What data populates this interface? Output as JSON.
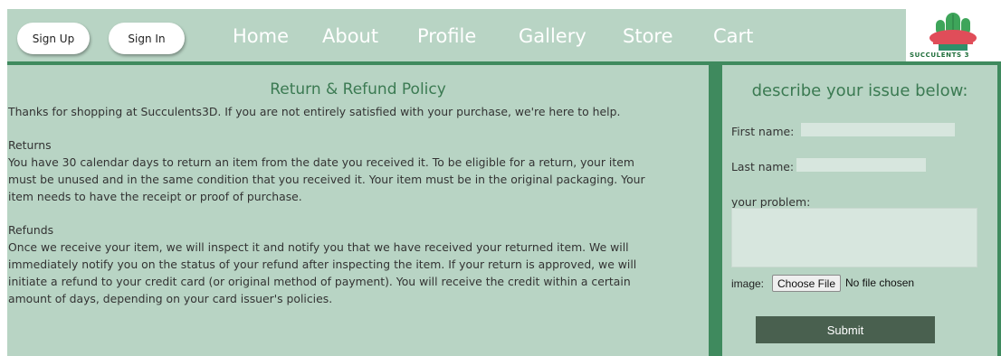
{
  "header": {
    "signup_label": "Sign Up",
    "signin_label": "Sign In",
    "nav": [
      "Home",
      "About",
      "Profile",
      "Gallery",
      "Store",
      "Cart"
    ],
    "logo_text": "SUCCULENTS 3"
  },
  "policy": {
    "title": "Return & Refund Policy",
    "intro": "Thanks for shopping at Succulents3D. If you are not entirely satisfied with your purchase, we're here to help.",
    "returns_heading": "Returns",
    "returns_lines": [
      "You have 30 calendar days to return an item from the date you received it. To be eligible for a return, your item",
      "must be unused and in the same condition that you received it. Your item must be in the original packaging. Your",
      "item needs to have the receipt or proof of purchase."
    ],
    "refunds_heading": "Refunds",
    "refunds_lines": [
      "Once we receive your item, we will inspect it and notify you that we have received your returned item. We will",
      "immediately notify you on the status of your refund after inspecting the item. If your return is approved, we will",
      "initiate a refund to your credit card (or original method of payment). You will receive the credit within a certain",
      "amount of days, depending on your card issuer's policies."
    ]
  },
  "form": {
    "title": "describe your issue below:",
    "first_name_label": "First name:",
    "first_name_value": "",
    "last_name_label": "Last name:",
    "last_name_value": "",
    "problem_label": "your problem:",
    "problem_value": "",
    "image_label": "image:",
    "choose_file_label": "Choose File",
    "file_status": "No file chosen",
    "submit_label": "Submit"
  },
  "colors": {
    "panel_bg": "#b8d4c4",
    "accent_green": "#3f8a5e",
    "heading_green": "#3b7a52",
    "submit_bg": "#49604f"
  }
}
